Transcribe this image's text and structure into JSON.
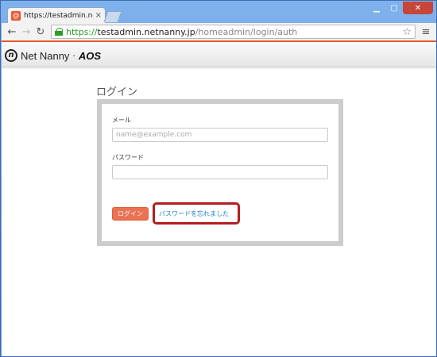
{
  "browser": {
    "tab_title": "https://testadmin.netn...",
    "tab_favicon": "netnanny-favicon",
    "url_scheme": "https://",
    "url_host": "testadmin.netnanny.jp",
    "url_path": "/homeadmin/login/auth",
    "icons": {
      "back": "back-arrow-icon",
      "forward": "forward-arrow-icon",
      "reload": "reload-icon",
      "lock": "lock-icon",
      "bookmark": "star-icon",
      "menu": "hamburger-menu-icon"
    }
  },
  "header": {
    "logo_mark": "n",
    "brand": "Net Nanny",
    "separator": "·",
    "partner": "AOS",
    "accent_color": "#e8572e"
  },
  "login": {
    "heading": "ログイン",
    "email_label": "メール",
    "email_placeholder": "name@example.com",
    "email_value": "",
    "password_label": "パスワード",
    "password_value": "",
    "login_button": "ログイン",
    "forgot_link": "パスワードを忘れました"
  },
  "colors": {
    "button": "#ea7252",
    "link": "#1d7fc4",
    "highlight": "#b21e1e",
    "panel_border": "#cccccc"
  }
}
